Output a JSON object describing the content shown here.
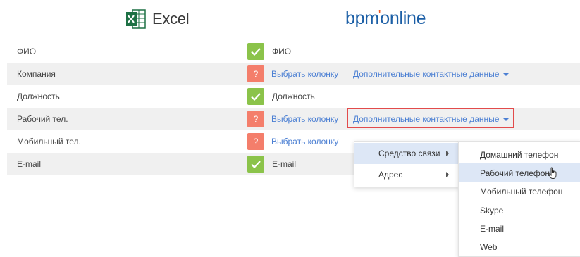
{
  "header": {
    "excel_label": "Excel",
    "bpm_left": "bpm",
    "bpm_right": "online"
  },
  "rows": [
    {
      "source": "ФИО",
      "status": "ok",
      "target": "ФИО"
    },
    {
      "source": "Компания",
      "status": "question",
      "link": "Выбрать колонку",
      "extra": "Дополнительные контактные данные"
    },
    {
      "source": "Должность",
      "status": "ok",
      "target": "Должность"
    },
    {
      "source": "Рабочий тел.",
      "status": "question",
      "link": "Выбрать колонку",
      "extra": "Дополнительные контактные данные"
    },
    {
      "source": "Мобильный тел.",
      "status": "question",
      "link": "Выбрать колонку"
    },
    {
      "source": "E-mail",
      "status": "ok",
      "target": "E-mail"
    }
  ],
  "status_q_label": "?",
  "menu_level1": [
    {
      "label": "Средство связи"
    },
    {
      "label": "Адрес"
    }
  ],
  "menu_level2": [
    {
      "label": "Домашний телефон"
    },
    {
      "label": "Рабочий телефон"
    },
    {
      "label": "Мобильный телефон"
    },
    {
      "label": "Skype"
    },
    {
      "label": "E-mail"
    },
    {
      "label": "Web"
    }
  ],
  "colors": {
    "ok": "#8bc34a",
    "question": "#f47e6b",
    "link": "#4b7fd3",
    "highlight_border": "#e24b4b",
    "menu_hover": "#dde7f6"
  }
}
